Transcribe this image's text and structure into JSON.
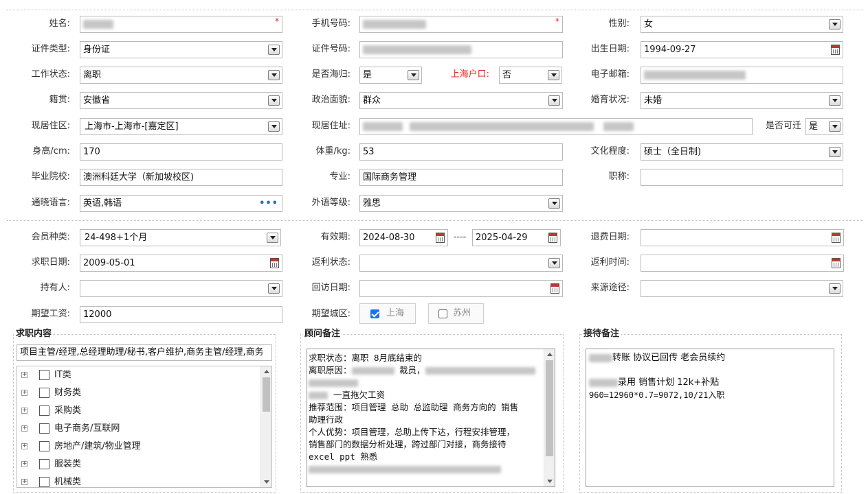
{
  "personal": {
    "name": {
      "label": "姓名:"
    },
    "phone": {
      "label": "手机号码:"
    },
    "gender": {
      "label": "性别:",
      "value": "女"
    },
    "id_type": {
      "label": "证件类型:",
      "value": "身份证"
    },
    "id_number": {
      "label": "证件号码:"
    },
    "birth_date": {
      "label": "出生日期:",
      "value": "1994-09-27"
    },
    "work_status": {
      "label": "工作状态:",
      "value": "离职"
    },
    "returnee": {
      "label": "是否海归:",
      "value": "是"
    },
    "shanghai_hukou": {
      "label": "上海户口:",
      "value": "否"
    },
    "email": {
      "label": "电子邮箱:"
    },
    "native_place": {
      "label": "籍贯:",
      "value": "安徽省"
    },
    "political_status": {
      "label": "政治面貌:",
      "value": "群众"
    },
    "marital_status": {
      "label": "婚育状况:",
      "value": "未婚"
    },
    "residence_area": {
      "label": "现居住区:",
      "value": "上海市-上海市-[嘉定区]"
    },
    "residence_address": {
      "label": "现居住址:"
    },
    "relocatable": {
      "label": "是否可迁",
      "value": "是"
    },
    "height": {
      "label": "身高/cm:",
      "value": "170"
    },
    "weight": {
      "label": "体重/kg:",
      "value": "53"
    },
    "education": {
      "label": "文化程度:",
      "value": "硕士（全日制)"
    },
    "school": {
      "label": "毕业院校:",
      "value": "澳洲科廷大学（新加坡校区)"
    },
    "major": {
      "label": "专业:",
      "value": "国际商务管理"
    },
    "title": {
      "label": "职称:",
      "value": ""
    },
    "languages": {
      "label": "通晓语言:",
      "value": "英语,韩语",
      "more": "•••"
    },
    "language_level": {
      "label": "外语等级:",
      "value": "雅思"
    }
  },
  "membership": {
    "member_type": {
      "label": "会员种类:",
      "value": "24-498+1个月"
    },
    "valid_period": {
      "label": "有效期:",
      "start": "2024-08-30",
      "sep": "----",
      "end": "2025-04-29"
    },
    "refund_date": {
      "label": "退费日期:",
      "value": ""
    },
    "job_search_date": {
      "label": "求职日期:",
      "value": "2009-05-01"
    },
    "rebate_status": {
      "label": "返利状态:",
      "value": ""
    },
    "rebate_time": {
      "label": "返利时间:",
      "value": ""
    },
    "holder": {
      "label": "持有人:",
      "value": ""
    },
    "followup_date": {
      "label": "回访日期:",
      "value": ""
    },
    "source": {
      "label": "来源途径:",
      "value": ""
    },
    "expected_salary": {
      "label": "期望工资:",
      "value": "12000"
    },
    "expected_city": {
      "label": "期望城区:",
      "options": [
        {
          "label": "上海",
          "checked": true
        },
        {
          "label": "苏州",
          "checked": false
        }
      ]
    }
  },
  "job_content": {
    "legend": "求职内容",
    "summary": "项目主管/经理,总经理助理/秘书,客户维护,商务主管/经理,商务",
    "categories": [
      "IT类",
      "财务类",
      "采购类",
      "电子商务/互联网",
      "房地产/建筑/物业管理",
      "服装类",
      "机械类"
    ]
  },
  "advisor_notes": {
    "legend": "顾问备注",
    "lines": [
      "",
      "求职状态：离职  8月底结束的",
      "离职原因：",
      "",
      "一直拖欠工资",
      "推荐范围：项目管理 总助 总监助理 商务方向的 销售",
      "助理行政",
      "个人优势：项目管理，总助上传下达，行程安排管理，",
      "销售部门的数据分析处理，跨过部门对接，商务接待",
      "excel ppt 熟悉",
      ""
    ],
    "inline": {
      "line3_suffix": "裁员，"
    }
  },
  "reception_notes": {
    "legend": "接待备注",
    "line1": "转账 协议已回传 老会员续约",
    "line2": "录用 销售计划 12k+补贴",
    "line3": "960=12960*0.7=9072,10/21入职"
  },
  "icons": {
    "required_mark": "*",
    "tree_expand": "+"
  }
}
